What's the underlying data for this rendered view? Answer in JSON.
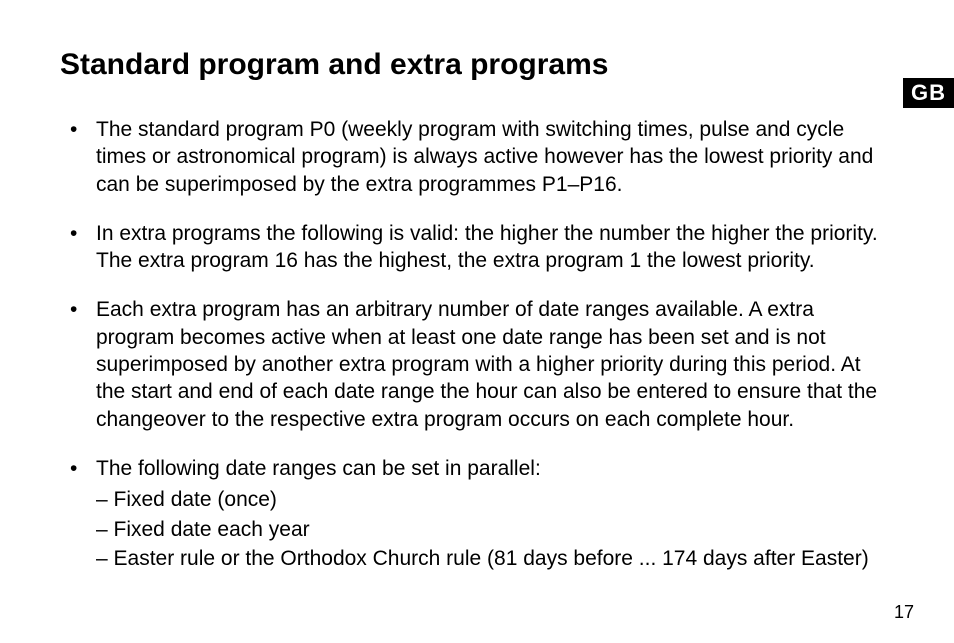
{
  "heading": "Standard program and extra programs",
  "language_badge": "GB",
  "bullets": [
    "The standard program P0 (weekly program with switching times, pulse and cycle times or astronomical program) is always active however has the lowest priority and can be superimposed by the extra programmes P1–P16.",
    "In extra programs the following is valid: the higher the number the higher the priority. The extra program 16 has the highest, the extra program 1 the lowest priority.",
    "Each extra program has an arbitrary number of date ranges available. A extra program becomes active when at least one date range has been set and is not superimposed by another extra program with a higher priority during this period. At the start and end of each date range the hour can also be entered to ensure that the changeover to the respective extra program occurs on each complete hour.",
    "The following date ranges can be set in parallel:"
  ],
  "sub_items": [
    "– Fixed date (once)",
    "– Fixed date each year",
    "– Easter rule or the Orthodox Church rule (81 days before ... 174 days after Easter)"
  ],
  "page_number": "17"
}
